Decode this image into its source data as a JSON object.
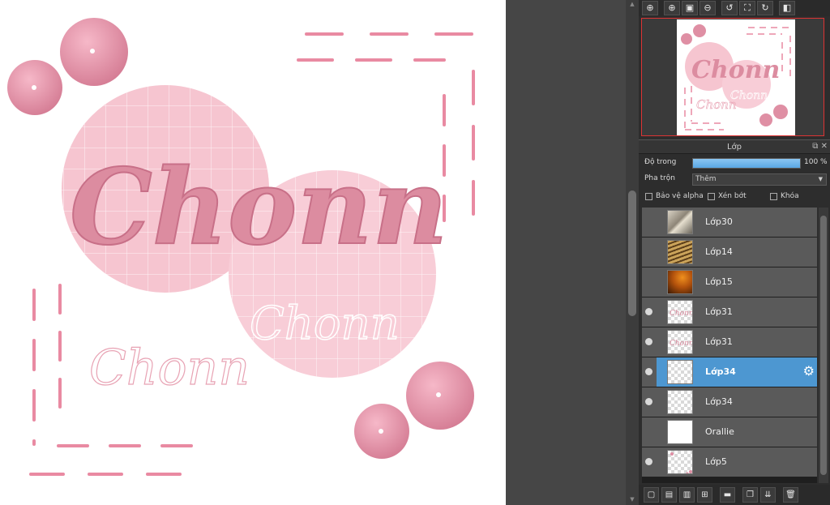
{
  "canvas": {
    "artwork_text": "Chonn",
    "colors": {
      "pink_dark": "#dc8ca0",
      "pink_light": "#f6c5d0",
      "dash": "#e98aa2"
    }
  },
  "navigator_toolbar": {
    "buttons": [
      {
        "name": "zoom-actual-icon",
        "glyph": "⊕"
      },
      {
        "name": "zoom-in-icon",
        "glyph": "⊕"
      },
      {
        "name": "fit-screen-icon",
        "glyph": "▣"
      },
      {
        "name": "zoom-out-icon",
        "glyph": "⊖"
      },
      {
        "name": "rotate-left-icon",
        "glyph": "↺"
      },
      {
        "name": "fullscreen-icon",
        "glyph": "⛶"
      },
      {
        "name": "rotate-right-icon",
        "glyph": "↻"
      },
      {
        "name": "flip-icon",
        "glyph": "◧"
      }
    ]
  },
  "layer_panel": {
    "title": "Lớp",
    "opacity_label": "Độ trong",
    "opacity_value": "100 %",
    "opacity_percent": 100,
    "blend_label": "Pha trộn",
    "blend_value": "Thêm",
    "checkboxes": {
      "protect_alpha": "Bảo vệ alpha",
      "clipping": "Xén bớt",
      "lock": "Khóa"
    },
    "layers": [
      {
        "name": "Lớp30",
        "visible": false,
        "selected": false,
        "thumb": "photo-light"
      },
      {
        "name": "Lớp14",
        "visible": false,
        "selected": false,
        "thumb": "photo-blinds"
      },
      {
        "name": "Lớp15",
        "visible": false,
        "selected": false,
        "thumb": "photo-orange"
      },
      {
        "name": "Lớp31",
        "visible": true,
        "selected": false,
        "thumb": "text"
      },
      {
        "name": "Lớp31",
        "visible": true,
        "selected": false,
        "thumb": "text"
      },
      {
        "name": "Lớp34",
        "visible": true,
        "selected": true,
        "thumb": "empty"
      },
      {
        "name": "Lớp34",
        "visible": true,
        "selected": false,
        "thumb": "empty"
      },
      {
        "name": "Orallie",
        "visible": false,
        "selected": false,
        "thumb": "white"
      },
      {
        "name": "Lớp5",
        "visible": true,
        "selected": false,
        "thumb": "dots"
      }
    ]
  },
  "bottom_toolbar": {
    "buttons": [
      {
        "name": "new-layer-icon",
        "glyph": "▢"
      },
      {
        "name": "new-raster-icon",
        "glyph": "▤"
      },
      {
        "name": "new-folder-layer-icon",
        "glyph": "▥"
      },
      {
        "name": "add-layer-menu-icon",
        "glyph": "⊞"
      },
      {
        "name": "folder-icon",
        "glyph": "▬"
      },
      {
        "name": "duplicate-layer-icon",
        "glyph": "❐"
      },
      {
        "name": "merge-layer-icon",
        "glyph": "⇊"
      },
      {
        "name": "delete-layer-icon",
        "glyph": "🗑"
      }
    ]
  }
}
